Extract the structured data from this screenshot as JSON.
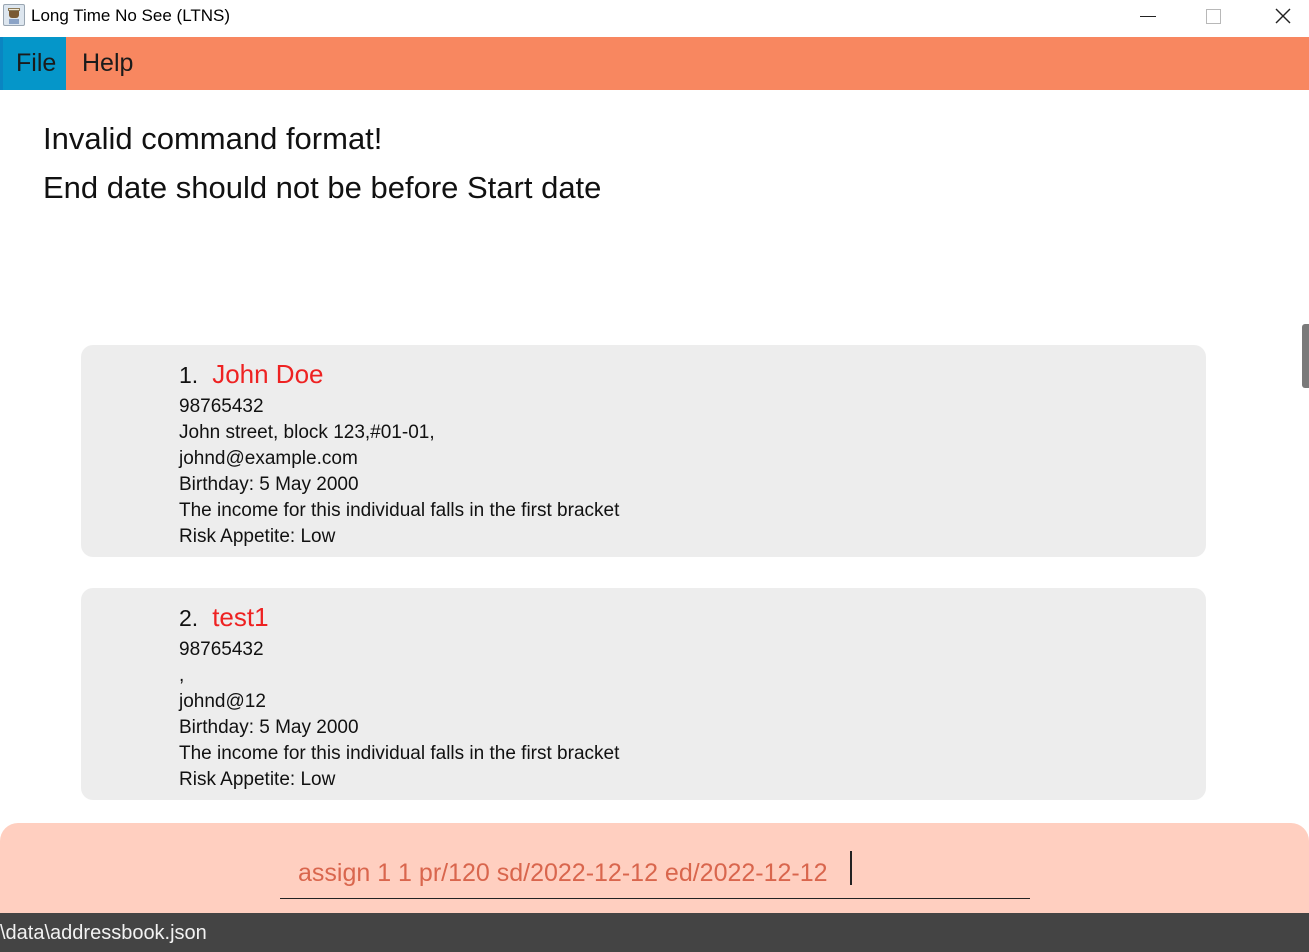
{
  "window": {
    "title": "Long Time No See (LTNS)",
    "close_glyph": "✕"
  },
  "menu": {
    "file": "File",
    "help": "Help"
  },
  "result": {
    "line1": "Invalid command format!",
    "line2": "End date should not be before Start date"
  },
  "persons": [
    {
      "index": "1.",
      "name": "John Doe",
      "phone": "98765432",
      "address": "John street, block 123,#01-01,",
      "email": "johnd@example.com",
      "birthday": "Birthday: 5 May 2000",
      "income": "The income for this individual falls in the first bracket",
      "risk": "Risk Appetite: Low"
    },
    {
      "index": "2.",
      "name": "test1",
      "phone": "98765432",
      "address": ",",
      "email": "johnd@12",
      "birthday": "Birthday: 5 May 2000",
      "income": "The income for this individual falls in the first bracket",
      "risk": "Risk Appetite: Low"
    }
  ],
  "command": {
    "value": "assign 1 1 pr/120 sd/2022-12-12 ed/2022-12-12"
  },
  "status": {
    "path": "\\data\\addressbook.json"
  },
  "colors": {
    "menu_bg": "#f88760",
    "menu_active": "#0596c9",
    "name_color": "#ee2222",
    "command_bg": "#ffcfc0",
    "command_text": "#d9664d",
    "status_bg": "#444444"
  },
  "icons": {
    "app": "coffee-cup-app-icon",
    "minimize": "minimize-icon",
    "maximize": "maximize-icon",
    "close": "close-icon"
  }
}
